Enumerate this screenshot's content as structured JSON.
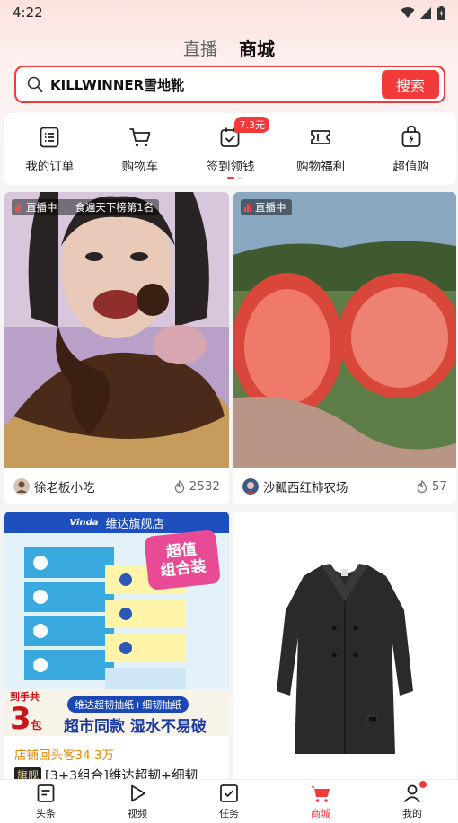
{
  "status_bar": {
    "time": "4:22"
  },
  "top_tabs": [
    {
      "label": "直播",
      "active": false
    },
    {
      "label": "商城",
      "active": true
    }
  ],
  "search": {
    "query": "KILLWINNER雪地靴",
    "button_label": "搜索"
  },
  "quick_actions": [
    {
      "label": "我的订单",
      "icon": "order-list-icon"
    },
    {
      "label": "购物车",
      "icon": "cart-icon"
    },
    {
      "label": "签到领钱",
      "icon": "checkin-icon",
      "badge": "7.3元"
    },
    {
      "label": "购物福利",
      "icon": "coupon-icon"
    },
    {
      "label": "超值购",
      "icon": "bag-lightning-icon"
    }
  ],
  "feed": {
    "card1": {
      "live_label": "直播中",
      "rank": "食遍天下榜第1名",
      "author": "徐老板小吃",
      "likes": "2532"
    },
    "card2": {
      "live_label": "直播中",
      "author": "沙瓤西红柿农场",
      "likes": "57"
    },
    "card3": {
      "banner": "维达旗舰店",
      "combo_line1": "超值",
      "combo_line2": "组合装",
      "promo_top": "到手共",
      "promo_num": "3",
      "promo_unit": "包",
      "promo_sub": "维达超韧抽纸+细韧抽纸",
      "promo_main": "超市同款 湿水不易破",
      "shop_stat": "店铺回头客34.3万",
      "flag": "旗舰",
      "title": "[3+3组合]维达超韧+细韧"
    }
  },
  "bottom_nav": [
    {
      "label": "头条",
      "icon": "news-icon",
      "active": false
    },
    {
      "label": "视频",
      "icon": "play-icon",
      "active": false
    },
    {
      "label": "任务",
      "icon": "task-check-icon",
      "active": false
    },
    {
      "label": "商城",
      "icon": "shop-cart-icon",
      "active": true
    },
    {
      "label": "我的",
      "icon": "user-icon",
      "active": false,
      "dot": true
    }
  ],
  "colors": {
    "accent": "#f23a3a",
    "vinda_blue": "#1d4fbf",
    "stat_orange": "#e08a00"
  }
}
